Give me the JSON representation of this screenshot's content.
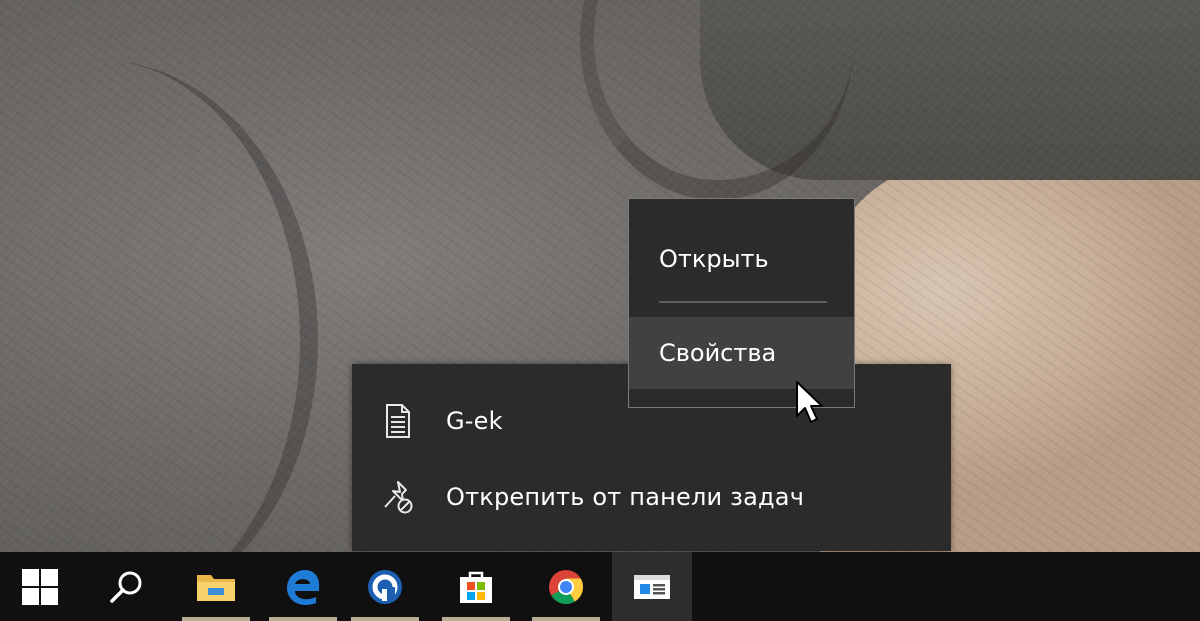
{
  "jump_list": {
    "items": [
      {
        "label": "G-ek",
        "icon": "document-icon"
      },
      {
        "label": "Открепить от панели задач",
        "icon": "unpin-icon"
      }
    ]
  },
  "sub_menu": {
    "items": [
      {
        "label": "Открыть",
        "highlighted": false
      },
      {
        "label": "Свойства",
        "highlighted": true
      }
    ]
  },
  "taskbar": {
    "buttons": [
      {
        "name": "windows-start-icon"
      },
      {
        "name": "search-icon"
      },
      {
        "name": "file-explorer-icon",
        "running": true
      },
      {
        "name": "edge-icon",
        "running": true
      },
      {
        "name": "blue-circle-app-icon",
        "running": true
      },
      {
        "name": "store-icon",
        "running": true
      },
      {
        "name": "chrome-icon",
        "running": true
      },
      {
        "name": "window-app-icon",
        "active": true
      }
    ]
  },
  "colors": {
    "menu_bg": "#2b2b2b",
    "menu_hover": "#414141",
    "taskbar_bg": "#101010",
    "running_indicator": "#b9ad95"
  }
}
